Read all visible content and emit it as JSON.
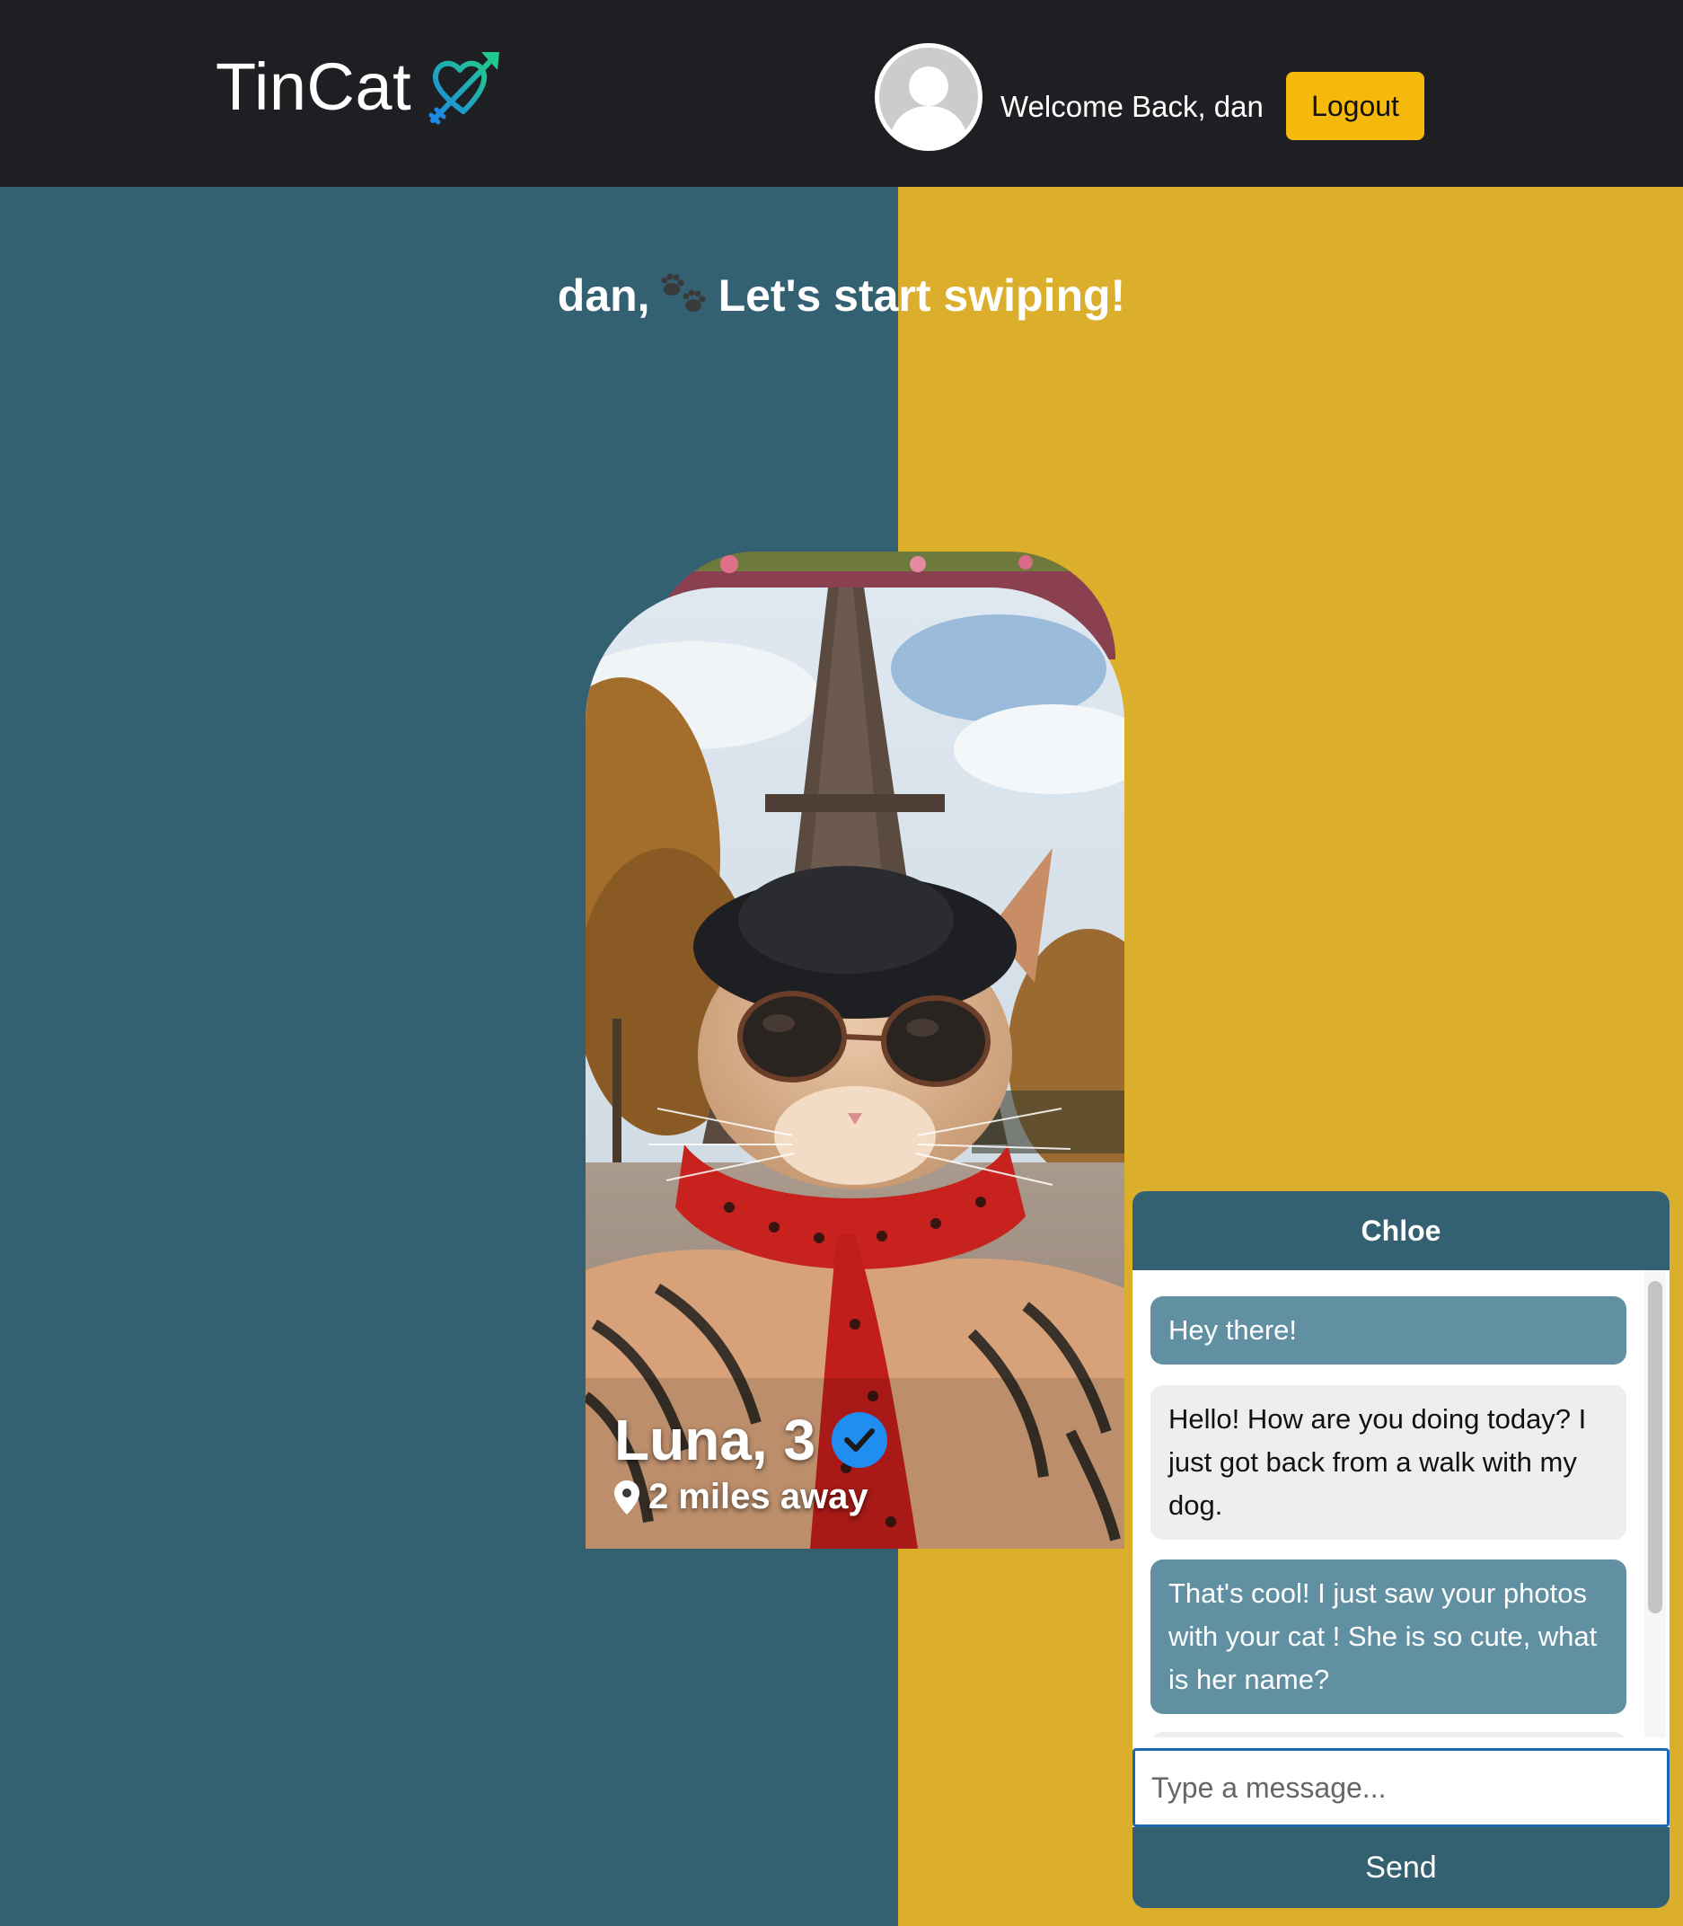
{
  "header": {
    "brand": "TinCat",
    "welcome_text": "Welcome Back, dan",
    "logout_label": "Logout"
  },
  "main": {
    "greeting_name": "dan,",
    "greeting_text": "Let's start swiping!"
  },
  "profile_card": {
    "name_age": "Luna, 3",
    "distance": "2 miles away",
    "verified": true
  },
  "chat": {
    "title": "Chloe",
    "messages": [
      {
        "from": "me",
        "text": "Hey there!"
      },
      {
        "from": "them",
        "text": "Hello! How are you doing today? I just got back from a walk with my dog."
      },
      {
        "from": "me",
        "text": "That's cool! I just saw your photos with your cat ! She is so cute, what is her name?"
      }
    ],
    "input_placeholder": "Type a message...",
    "send_label": "Send"
  },
  "colors": {
    "navbar": "#1e1f23",
    "teal": "#346172",
    "mustard": "#dbaf2c",
    "logout": "#f4b90b",
    "bubble_mine": "#6190a2",
    "bubble_theirs": "#eeeeee",
    "verified": "#1f8ef0"
  }
}
